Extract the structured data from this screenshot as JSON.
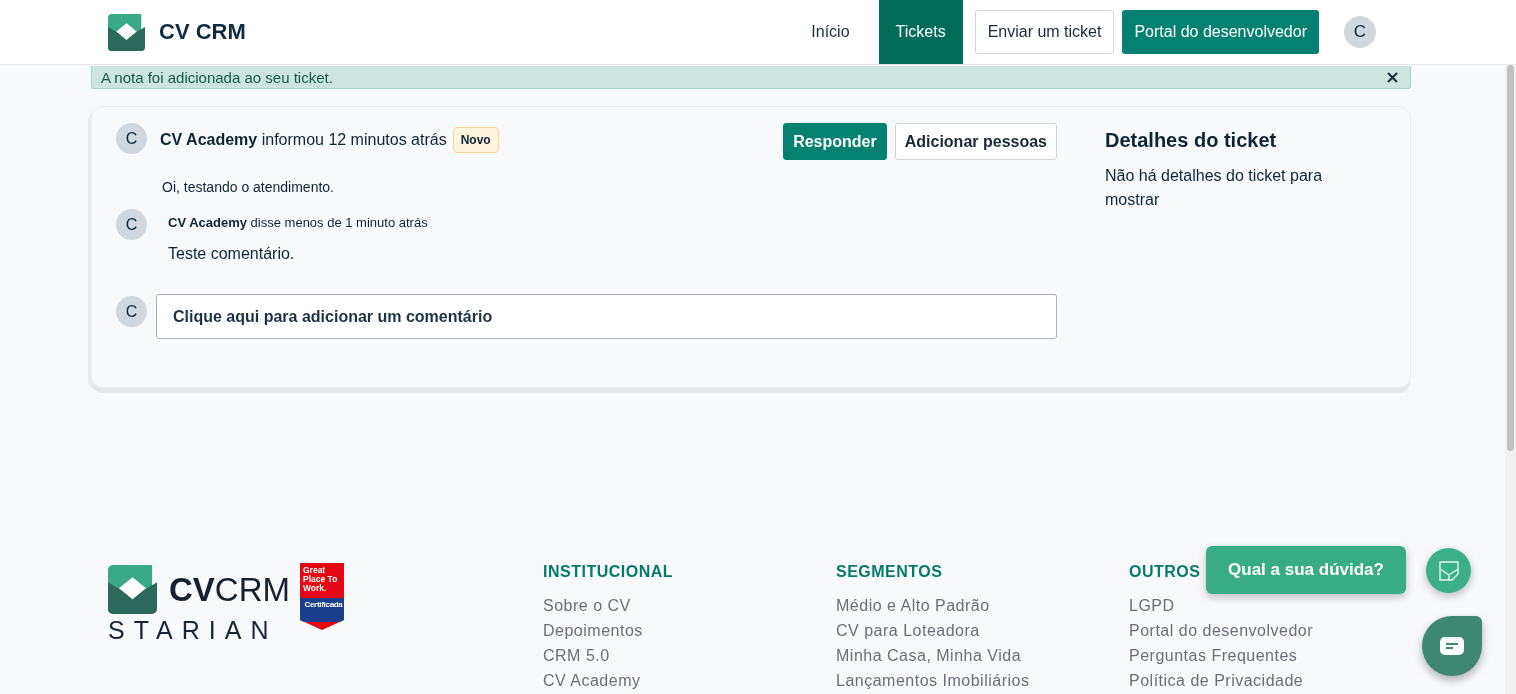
{
  "header": {
    "brand": "CV CRM",
    "nav": [
      {
        "label": "Início",
        "kind": "tab",
        "selected": false
      },
      {
        "label": "Tickets",
        "kind": "tab",
        "selected": true
      },
      {
        "label": "Enviar um ticket",
        "kind": "outline",
        "selected": false
      },
      {
        "label": "Portal do desenvolvedor",
        "kind": "primary",
        "selected": false
      }
    ],
    "avatar": "C"
  },
  "notice": {
    "text": "A nota foi adicionada ao seu ticket."
  },
  "ticket": {
    "avatar": "C",
    "author": "CV Academy",
    "action": "informou 12 minutos atrás",
    "badge": "Novo",
    "body": "Oi, testando o atendimento.",
    "actions": [
      {
        "label": "Responder",
        "kind": "primary"
      },
      {
        "label": "Adicionar pessoas",
        "kind": "outline"
      }
    ],
    "comments": [
      {
        "avatar": "C",
        "author": "CV Academy",
        "action": "disse menos de 1 minuto atrás",
        "body": "Teste comentário."
      }
    ],
    "comment_box": {
      "avatar": "C",
      "placeholder": "Clique aqui para adicionar um comentário"
    }
  },
  "details": {
    "title": "Detalhes do ticket",
    "text": "Não há detalhes do ticket para mostrar"
  },
  "footer": {
    "logo": {
      "bold": "CV",
      "light": "CRM",
      "company": "STARIAN",
      "seal_title": "Great Place To Work.",
      "seal_label": "Certificada"
    },
    "columns": [
      {
        "title": "INSTITUCIONAL",
        "links": [
          "Sobre o CV",
          "Depoimentos",
          "CRM 5.0",
          "CV Academy"
        ]
      },
      {
        "title": "SEGMENTOS",
        "links": [
          "Médio e Alto Padrão",
          "CV para Loteadora",
          "Minha Casa, Minha Vida",
          "Lançamentos Imobiliários"
        ]
      },
      {
        "title": "OUTROS",
        "links": [
          "LGPD",
          "Portal do desenvolvedor",
          "Perguntas Frequentes",
          "Política de Privacidade"
        ]
      }
    ]
  },
  "widgets": {
    "help": "Qual a sua dúvida?"
  }
}
